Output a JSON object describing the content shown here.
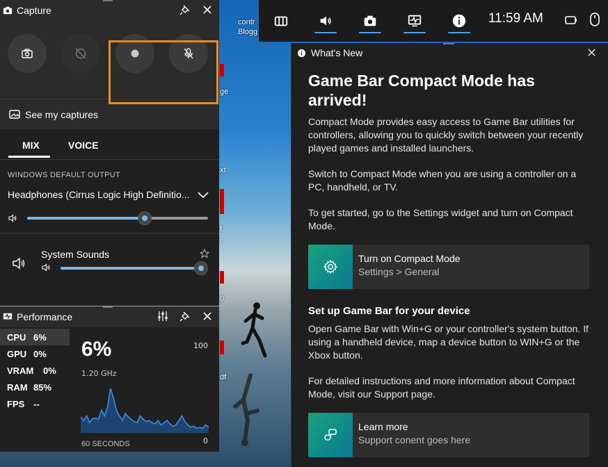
{
  "desktop": {
    "labels": [
      "contr",
      "Blogg",
      "ge",
      "xt",
      "f",
      "r",
      "0",
      "df"
    ]
  },
  "topbar": {
    "clock": "11:59 AM",
    "icons": [
      "widget-menu-icon",
      "audio-icon",
      "capture-icon",
      "performance-icon",
      "info-icon"
    ]
  },
  "capture": {
    "title": "Capture",
    "see_captures": "See my captures",
    "tabs": {
      "mix": "MIX",
      "voice": "VOICE"
    },
    "output_label": "WINDOWS DEFAULT OUTPUT",
    "device": "Headphones (Cirrus Logic High Definitio...",
    "master_volume": 0.65,
    "system_sounds_label": "System Sounds",
    "system_volume": 1.0
  },
  "performance": {
    "title": "Performance",
    "metrics": [
      {
        "k": "CPU",
        "v": "6%"
      },
      {
        "k": "GPU",
        "v": "0%"
      },
      {
        "k": "VRAM",
        "v": "0%"
      },
      {
        "k": "RAM",
        "v": "85%"
      },
      {
        "k": "FPS",
        "v": "--"
      }
    ],
    "big_value": "6%",
    "ghz": "1.20 GHz",
    "max_label": "100",
    "min_label": "0",
    "duration_label": "60 SECONDS",
    "graph_values": [
      28,
      22,
      30,
      18,
      25,
      26,
      24,
      40,
      30,
      45,
      78,
      62,
      40,
      30,
      22,
      34,
      28,
      24,
      20,
      18,
      30,
      24,
      20,
      22,
      18,
      16,
      22,
      14,
      18,
      22,
      16,
      12,
      14,
      22,
      30,
      20,
      14,
      10,
      12,
      8,
      10,
      8,
      14,
      10
    ]
  },
  "whatsnew": {
    "header": "What's New",
    "title": "Game Bar Compact Mode has arrived!",
    "p1": "Compact Mode provides easy access to Game Bar utilities for controllers, allowing you to quickly switch between your recently played games and installed launchers.",
    "p2": "Switch to Compact Mode when you are using a controller on a PC, handheld, or TV.",
    "p3": "To get started, go to the Settings widget and turn on Compact Mode.",
    "card1": {
      "title": "Turn on Compact Mode",
      "subtitle": "Settings > General"
    },
    "h2": "Set up Game Bar for your device",
    "p4": "Open Game Bar with Win+G or your controller's system button. If using a handheld device, map a device button to WIN+G or the Xbox button.",
    "p5": "For detailed instructions and more information about Compact Mode, visit our Support page.",
    "card2": {
      "title": "Learn more",
      "subtitle": "Support conent goes here"
    }
  }
}
